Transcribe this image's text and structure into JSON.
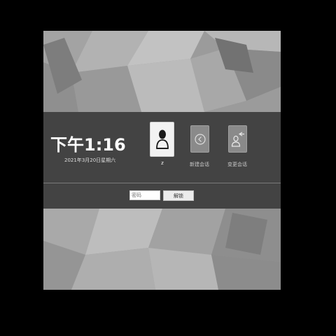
{
  "lock_screen": {
    "time": "下午1:16",
    "date": "2021年3月20日星期六"
  },
  "sessions": {
    "user": {
      "label": "z",
      "icon": "user-icon"
    },
    "new_session": {
      "label": "新建会话",
      "icon": "new-session-icon"
    },
    "switch_session": {
      "label": "变更会话",
      "icon": "switch-session-icon"
    }
  },
  "login": {
    "password_placeholder": "密码",
    "password_value": "",
    "unlock_label": "解锁"
  },
  "colors": {
    "panel": "#3c3c3c",
    "background": "#9a9a9a",
    "tile_active": "#f2f2f2",
    "tile_inactive": "#8a8a8a"
  }
}
